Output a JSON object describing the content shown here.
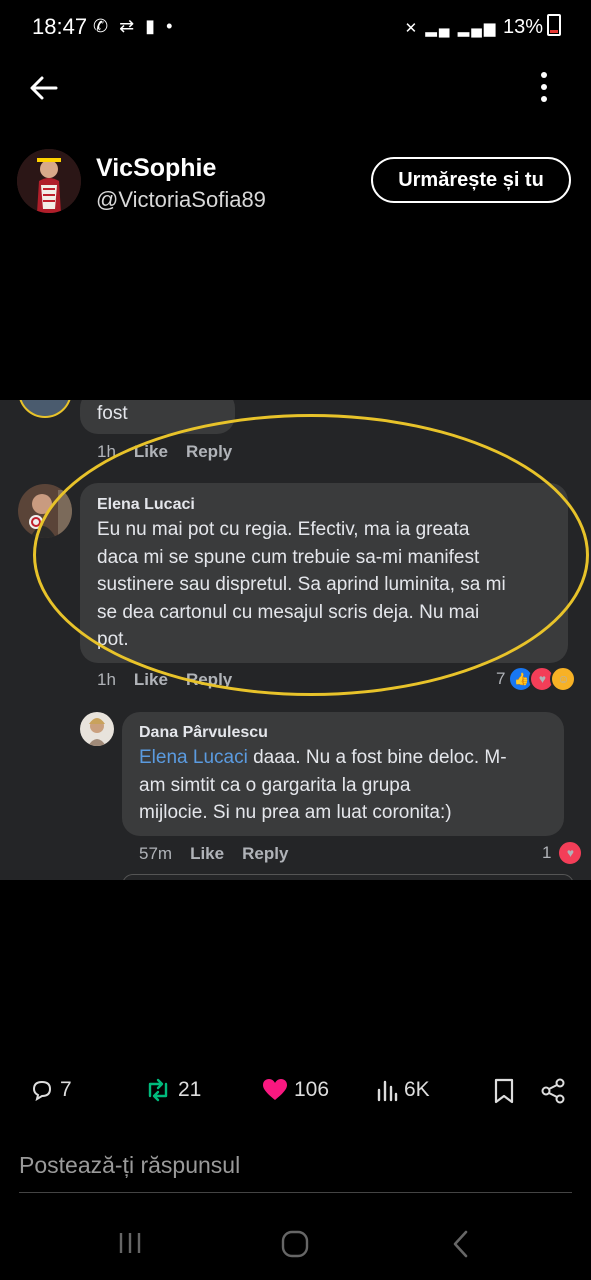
{
  "status_bar": {
    "time": "18:47",
    "left_icons": "✆ ⇄ ▮ •",
    "right_text": "13%"
  },
  "header": {
    "back_icon": "arrow-left-icon",
    "menu_icon": "more-vertical-icon"
  },
  "profile": {
    "display_name": "VicSophie",
    "handle": "@VictoriaSofia89",
    "follow_label": "Urmărește și tu"
  },
  "embedded_screenshot": {
    "top_comment": {
      "text": "fost",
      "time": "1h",
      "like_label": "Like",
      "reply_label": "Reply"
    },
    "comment_main": {
      "author": "Elena Lucaci",
      "lines": [
        "Eu nu mai pot cu regia. Efectiv, ma ia greata",
        "daca mi se spune cum trebuie sa-mi manifest",
        "sustinere sau dispretul. Sa aprind luminita, sa mi",
        "se dea cartonul cu mesajul scris deja. Nu mai",
        "pot."
      ],
      "time": "1h",
      "like_label": "Like",
      "reply_label": "Reply",
      "reaction_count": "7"
    },
    "comment_reply": {
      "author": "Dana Pârvulescu",
      "mention": "Elena Lucaci",
      "line1_rest": " daaa. Nu a fost bine deloc. M-",
      "line2": "am simtit ca o gargarita la grupa",
      "line3": "mijlocie. Si nu prea am luat coronita:)",
      "time": "57m",
      "like_label": "Like",
      "reply_label": "Reply",
      "reaction_count": "1"
    },
    "highlight_color": "#e8c32a"
  },
  "actions": {
    "replies": "7",
    "retweets": "21",
    "likes": "106",
    "views": "6K",
    "retweet_color": "#00ba7c",
    "like_color": "#f91880"
  },
  "reply_box": {
    "placeholder": "Postează-ți răspunsul"
  }
}
